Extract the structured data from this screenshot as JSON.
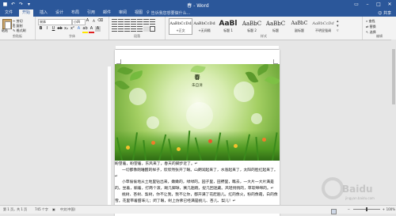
{
  "app": {
    "title": "春 - Word"
  },
  "quick_access": [
    "save-icon",
    "undo-icon",
    "redo-icon",
    "customize-icon"
  ],
  "tabs": [
    {
      "label": "文件"
    },
    {
      "label": "开始"
    },
    {
      "label": "插入"
    },
    {
      "label": "设计"
    },
    {
      "label": "布局"
    },
    {
      "label": "引用"
    },
    {
      "label": "邮件"
    },
    {
      "label": "审阅"
    },
    {
      "label": "视图"
    }
  ],
  "active_tab": "开始",
  "tell_me": "告诉我您想要做什么...",
  "share": "共享",
  "ribbon": {
    "clipboard": {
      "group": "剪贴板",
      "paste": "粘贴",
      "cut": "剪切",
      "copy": "复制",
      "format_painter": "格式刷"
    },
    "font": {
      "group": "字体",
      "font_name": "宋体",
      "font_size": "小四"
    },
    "paragraph": {
      "group": "段落"
    },
    "styles": {
      "group": "样式",
      "items": [
        {
          "preview": "AaBbCcDd",
          "name": "+正文"
        },
        {
          "preview": "AaBbCcDd",
          "name": "+无间隔"
        },
        {
          "preview": "AaBl",
          "name": "标题 1"
        },
        {
          "preview": "AaBbC",
          "name": "标题 2"
        },
        {
          "preview": "AaBbC",
          "name": "标题"
        },
        {
          "preview": "AaBbC",
          "name": "副标题"
        },
        {
          "preview": "AaBbCcDd",
          "name": "不明显强调"
        }
      ]
    },
    "editing": {
      "group": "编辑",
      "find": "查找",
      "replace": "替换",
      "select": "选择"
    }
  },
  "document": {
    "title": "春",
    "author": "朱自清",
    "paragraphs": [
      "盼望着，盼望着，东风来了，春天的脚步近了。",
      "一切都像刚睡醒的样子，欣欣然张开了眼。山朗润起来了，水涨起来了，太阳的脸红起来了。",
      "小草偷偷地从土地里钻出来，嫩嫩的，绿绿的。园子里，田野里，瞧去，一大片一大片满是的。坐着，躺着，打两个滚，踢几脚球，赛几趟跑，捉几回迷藏。风轻悄悄的，草软绵绵的。",
      "桃树、杏树、梨树，你不让我，我不让你，都开满了花赶趟儿。红的像火，粉的像霞，白的像雪。花里带着甜味儿；闭了眼，树上仿佛已经满是桃儿、杏儿、梨儿！"
    ]
  },
  "status": {
    "page": "第 1 页，共 1 页",
    "words": "745 个字",
    "language": "中文(中国)",
    "zoom": "100%"
  },
  "watermark": {
    "text": "Baidu",
    "sub": "jingyan.baidu.com"
  }
}
